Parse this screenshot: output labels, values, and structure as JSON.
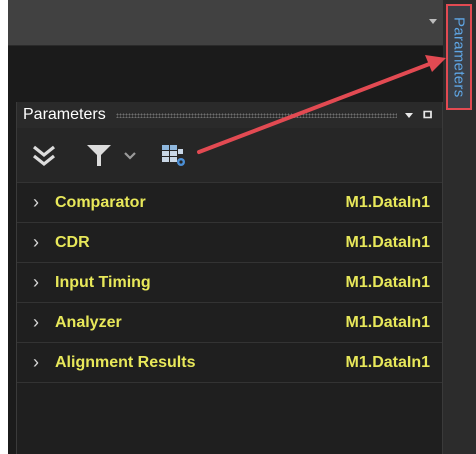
{
  "side_tab": {
    "label": "Parameters"
  },
  "panel": {
    "title": "Parameters",
    "rows": [
      {
        "name": "Comparator",
        "value": "M1.DataIn1"
      },
      {
        "name": "CDR",
        "value": "M1.DataIn1"
      },
      {
        "name": "Input Timing",
        "value": "M1.DataIn1"
      },
      {
        "name": "Analyzer",
        "value": "M1.DataIn1"
      },
      {
        "name": "Alignment Results",
        "value": "M1.DataIn1"
      }
    ]
  },
  "colors": {
    "highlight": "#e24a52",
    "row_text": "#e8e85a",
    "tab_text": "#5fa6e6"
  },
  "icons": {
    "toolbar": [
      "collapse-all-icon",
      "filter-icon",
      "chevron-down-icon",
      "grid-settings-icon"
    ],
    "header": [
      "chevron-down-icon",
      "pin-icon"
    ],
    "rows": "chevron-right-icon"
  }
}
